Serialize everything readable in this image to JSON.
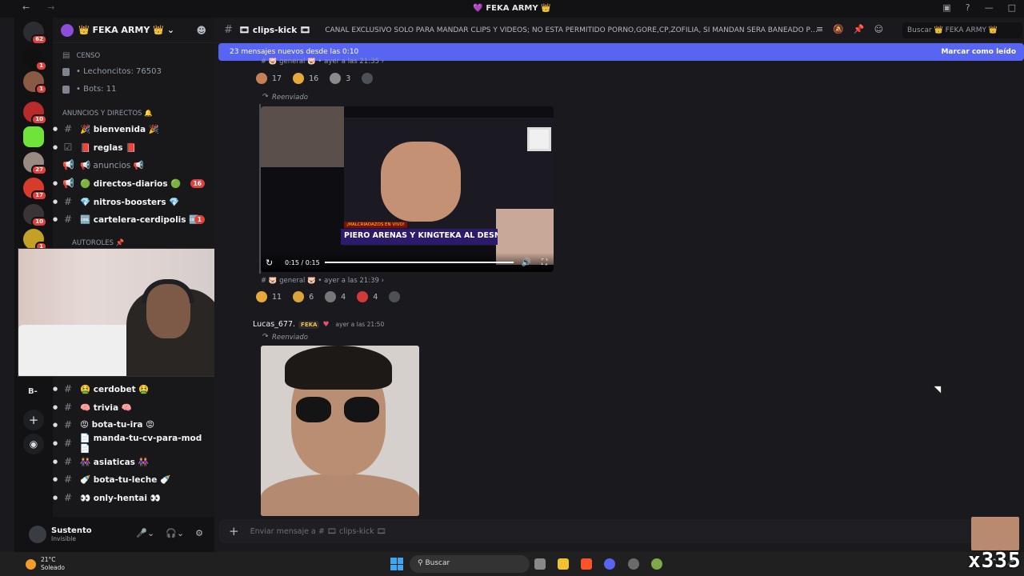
{
  "window": {
    "title": "💜 FEKA ARMY 👑"
  },
  "servers": [
    {
      "badge": "62"
    },
    {
      "badge": "1"
    },
    {
      "badge": "1"
    },
    {
      "badge": "10"
    },
    {
      "badge": ""
    },
    {
      "badge": "27"
    },
    {
      "badge": "17"
    },
    {
      "badge": "10"
    },
    {
      "badge": "1"
    }
  ],
  "sidebar": {
    "guild_name": "👑 FEKA ARMY 👑",
    "census": "CENSO",
    "lechoncitos": "• Lechoncitos: 76503",
    "bots": "• Bots: 11",
    "cat_announcements": "ANUNCIOS Y DIRECTOS 🔔",
    "cat_autoroles": "AUTOROLES 📌",
    "channels_top": [
      {
        "label": "🎉 bienvenida 🎉",
        "count": ""
      },
      {
        "label": "📕 reglas 📕",
        "count": ""
      },
      {
        "label": "📢 anuncios 📢",
        "count": ""
      },
      {
        "label": "🟢 directos-diarios 🟢",
        "count": "16"
      },
      {
        "label": "💎 nitros-boosters 💎",
        "count": ""
      },
      {
        "label": "🆒 cartelera-cerdipolis 🆒",
        "count": "1"
      }
    ],
    "channels_bottom": [
      {
        "label": "🤮 cerdobet 🤮"
      },
      {
        "label": "🧠 trivia 🧠"
      },
      {
        "label": "😡 bota-tu-ira 😡"
      },
      {
        "label": "📄 manda-tu-cv-para-mod 📄"
      },
      {
        "label": "👭 asiaticas 👭"
      },
      {
        "label": "🍼 bota-tu-leche 🍼"
      },
      {
        "label": "👀 only-hentai 👀"
      }
    ],
    "side_letter": "B-"
  },
  "user": {
    "name": "Sustento",
    "status": "Invisible"
  },
  "channel": {
    "name": "🎞 clips-kick 🎞",
    "topic": "CANAL EXCLUSIVO SOLO PARA MANDAR CLIPS Y VIDEOS; NO ESTA PERMITIDO PORNO,GORE,CP,ZOFILIA, SI MANDAN SERA BANEADO PERMA...",
    "search_placeholder": "Buscar 👑 FEKA ARMY 👑"
  },
  "banner": {
    "text": "23 mensajes nuevos desde las 0:10",
    "mark": "Marcar como leído"
  },
  "msg1": {
    "origin": "# 🐷 general 🐷 • ayer a las 21:35 ›",
    "reactions": [
      {
        "count": "17"
      },
      {
        "count": "16"
      },
      {
        "count": "3"
      }
    ]
  },
  "forward_label": "Reenviado",
  "video": {
    "title": "PIERO ARENAS Y KINGTEKA AL DESNUDO",
    "subtitle": "¡MALCRIADAZOS EN VIVO!",
    "time": "0:15 / 0:15",
    "progress": 1.0
  },
  "msg2": {
    "origin": "# 🐷 general 🐷 • ayer a las 21:39 ›",
    "reactions": [
      {
        "count": "11"
      },
      {
        "count": "6"
      },
      {
        "count": "4"
      },
      {
        "count": "4"
      }
    ]
  },
  "msg3": {
    "author": "Lucas_677.",
    "tag": "FEKA",
    "time": "ayer a las 21:50"
  },
  "composer": {
    "placeholder": "Enviar mensaje a # 🎞 clips-kick 🎞"
  },
  "taskbar": {
    "temp": "21°C",
    "weather": "Soleado",
    "search": "Buscar"
  },
  "overlay_text": "x335"
}
